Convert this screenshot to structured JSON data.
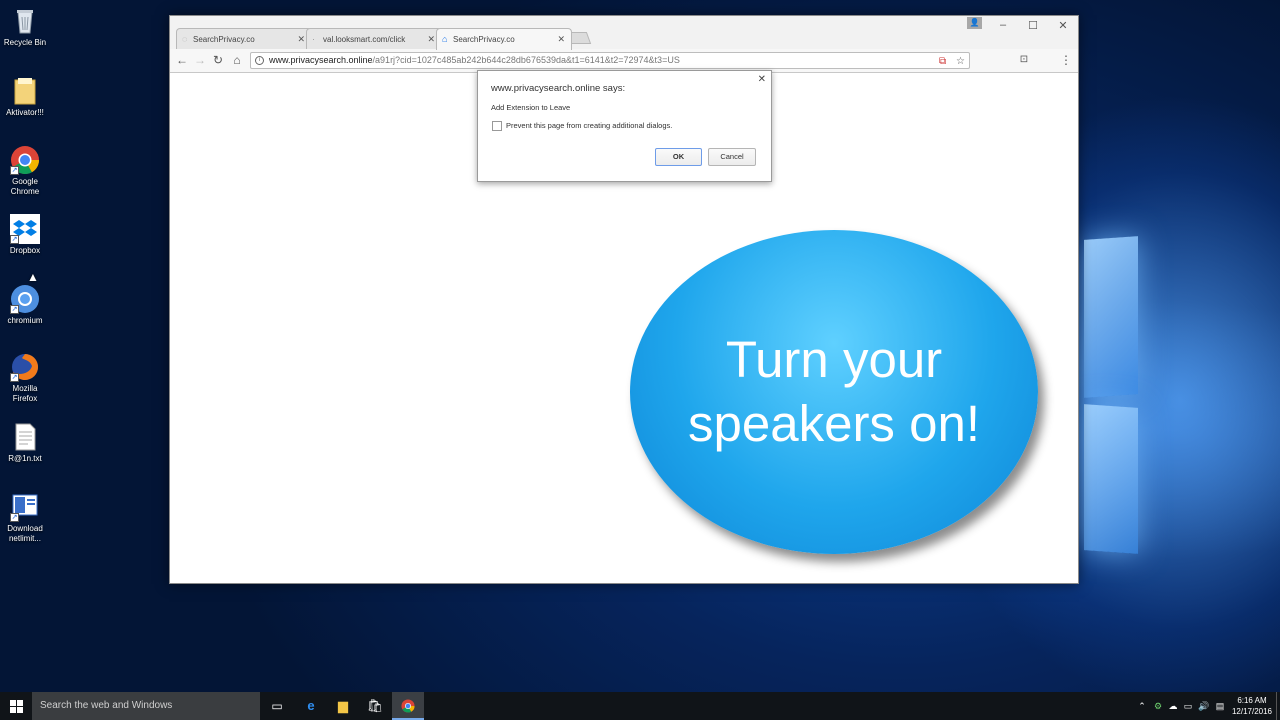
{
  "desktop": {
    "icons": [
      {
        "label": "Recycle Bin",
        "icon": "recycle-bin-icon"
      },
      {
        "label": "Aktivator!!!",
        "icon": "folder-icon"
      },
      {
        "label": "Google Chrome",
        "icon": "chrome-icon"
      },
      {
        "label": "Dropbox",
        "icon": "dropbox-icon"
      },
      {
        "label": "chromium",
        "icon": "chromium-icon"
      },
      {
        "label": "Mozilla Firefox",
        "icon": "firefox-icon"
      },
      {
        "label": "R@1n.txt",
        "icon": "text-file-icon"
      },
      {
        "label": "Download netlimit...",
        "icon": "installer-icon"
      }
    ]
  },
  "browser": {
    "tabs": [
      {
        "label": "SearchPrivacy.co",
        "icon": "loading-icon",
        "active": false
      },
      {
        "label": "val.looksmart.com/click",
        "icon": "loading-icon",
        "active": false
      },
      {
        "label": "SearchPrivacy.co",
        "icon": "home-icon",
        "active": true
      }
    ],
    "url_host": "www.privacysearch.online",
    "url_path": "/a91rj?cid=1027c485ab242b644c28db676539da&t1=6141&t2=72974&t3=US"
  },
  "dialog": {
    "title": "www.privacysearch.online says:",
    "message": "Add Extension to Leave",
    "checkbox_label": "Prevent this page from creating additional dialogs.",
    "checkbox_checked": false,
    "ok_label": "OK",
    "cancel_label": "Cancel"
  },
  "page": {
    "speaker_message": "Turn your speakers on!"
  },
  "taskbar": {
    "search_placeholder": "Search the web and Windows",
    "pinned": [
      "task-view-icon",
      "edge-icon",
      "file-explorer-icon",
      "store-icon",
      "chrome-icon"
    ],
    "time": "6:16 AM",
    "date": "12/17/2016"
  },
  "colors": {
    "speaker_blue": "#1fa6ec",
    "taskbar": "#101418",
    "desktop": "#06245c"
  }
}
